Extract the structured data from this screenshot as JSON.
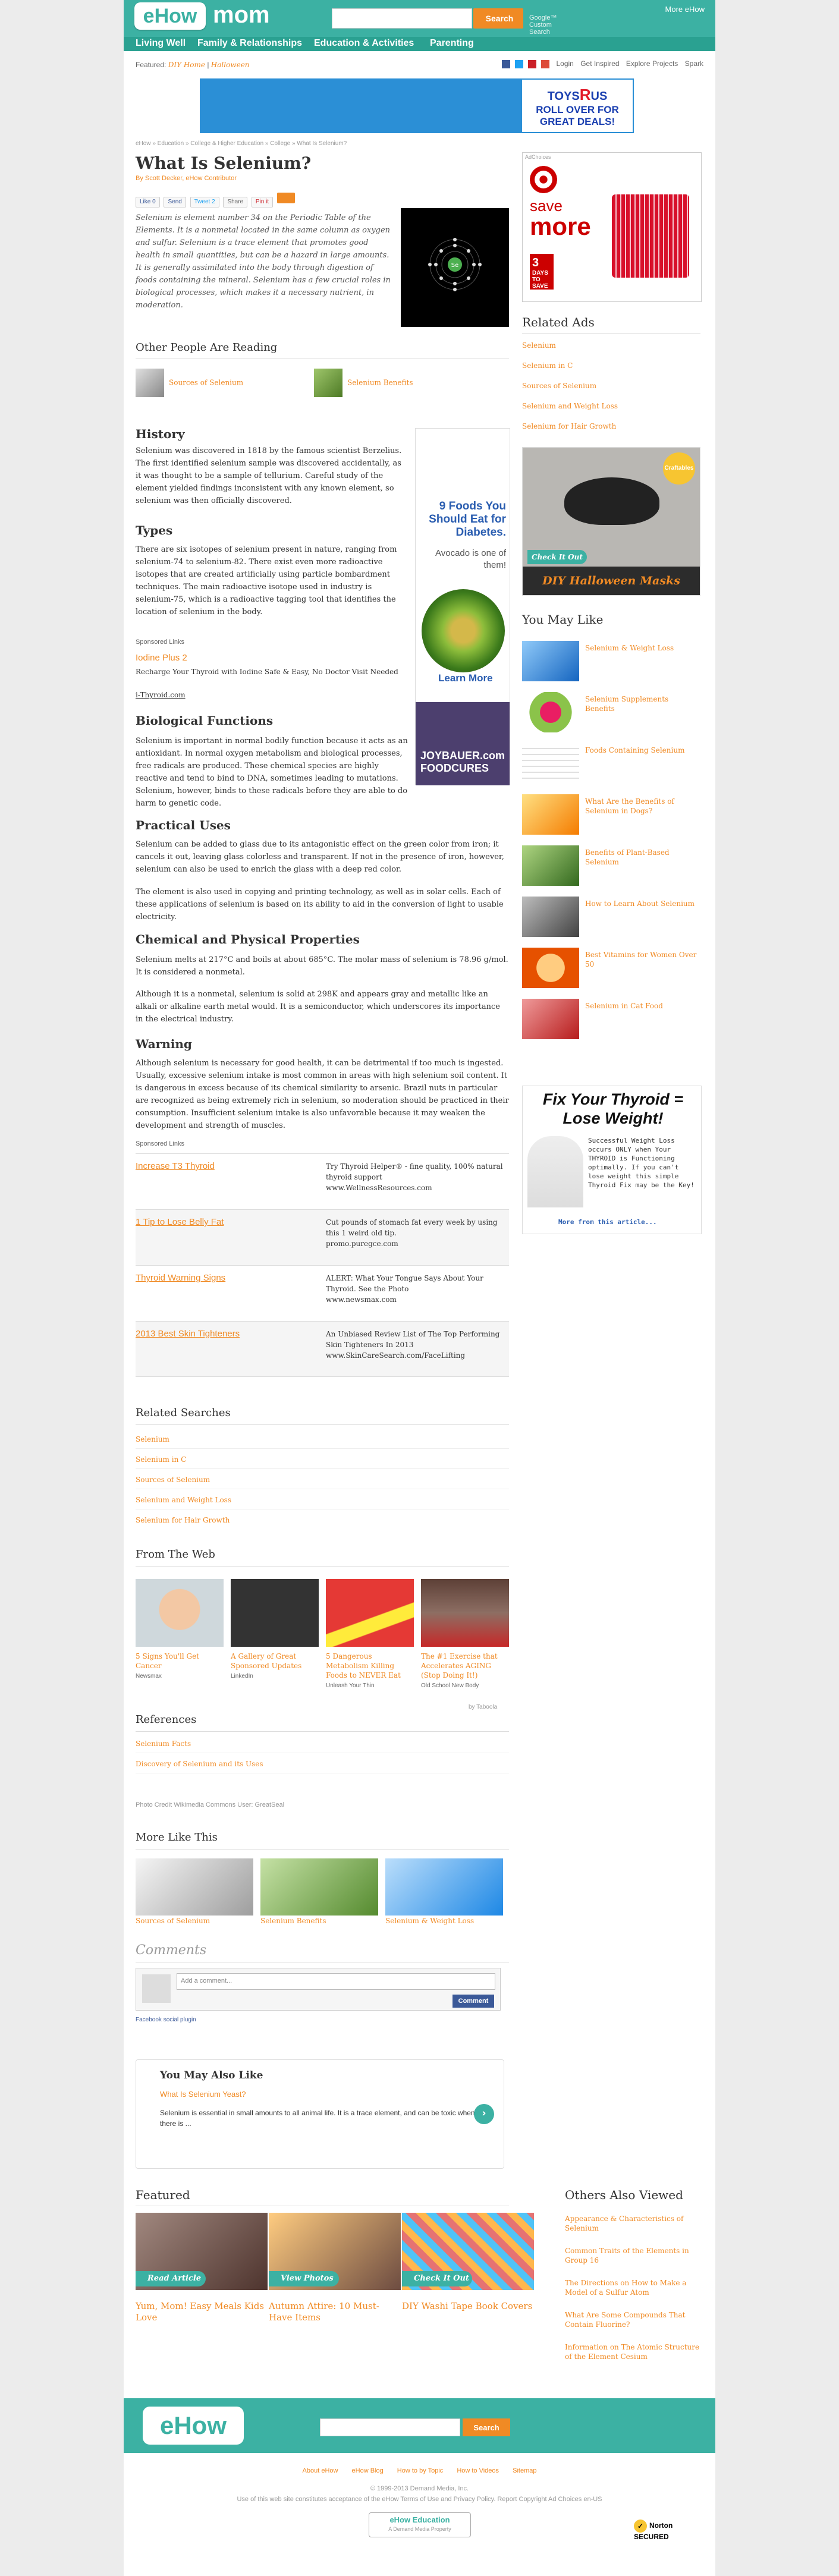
{
  "header": {
    "logo_ehow": "eHow",
    "logo_mom": "mom",
    "search_button": "Search",
    "custom_search": "Google™ Custom Search",
    "more_ehow": "More eHow",
    "nav": [
      "Living Well",
      "Family & Relationships",
      "Education & Activities",
      "Parenting"
    ]
  },
  "featured_bar": {
    "label": "Featured:",
    "links": [
      "DIY Home",
      "Halloween"
    ],
    "right": [
      "Login",
      "Get Inspired",
      "Explore Projects",
      "Spark"
    ]
  },
  "banner_ad": {
    "brand_a": "TOYS",
    "brand_b": "R",
    "brand_c": "US",
    "line1": "ROLL OVER FOR",
    "line2": "GREAT DEALS!"
  },
  "article": {
    "breadcrumb": "eHow » Education » College & Higher Education » College » What Is Selenium?",
    "title": "What Is Selenium?",
    "byline": "By Scott Decker, eHow Contributor",
    "share": {
      "like": "Like",
      "like_count": "0",
      "send": "Send",
      "tweet": "Tweet",
      "tweet_count": "2",
      "share": "Share",
      "pin": "Pin it"
    },
    "intro": "Selenium is element number 34 on the Periodic Table of the Elements. It is a nonmetal located in the same column as oxygen and sulfur. Selenium is a trace element that promotes good health in small quantities, but can be a hazard in large amounts. It is generally assimilated into the body through digestion of foods containing the mineral. Selenium has a few crucial roles in biological processes, which makes it a necessary nutrient, in moderation.",
    "atom_label": "Se",
    "other_reading_heading": "Other People Are Reading",
    "other_reading": [
      "Sources of Selenium",
      "Selenium Benefits"
    ],
    "history_h": "History",
    "history": "Selenium was discovered in 1818 by the famous scientist Berzelius. The first identified selenium sample was discovered accidentally, as it was thought to be a sample of tellurium. Careful study of the element yielded findings inconsistent with any known element, so selenium was then officially discovered.",
    "types_h": "Types",
    "types": "There are six isotopes of selenium present in nature, ranging from selenium-74 to selenium-82. There exist even more radioactive isotopes that are created artificially using particle bombardment techniques. The main radioactive isotope used in industry is selenium-75, which is a radioactive tagging tool that identifies the location of selenium in the body.",
    "sponsored_label": "Sponsored Links",
    "sp_title": "Iodine Plus 2",
    "sp_desc": "Recharge Your Thyroid with Iodine Safe & Easy, No Doctor Visit Needed",
    "sp_url": "i-Thyroid.com",
    "bio_h": "Biological Functions",
    "bio": "Selenium is important in normal bodily function because it acts as an antioxidant. In normal oxygen metabolism and biological processes, free radicals are produced. These chemical species are highly reactive and tend to bind to DNA, sometimes leading to mutations. Selenium, however, binds to these radicals before they are able to do harm to genetic code.",
    "practical_h": "Practical Uses",
    "practical1": "Selenium can be added to glass due to its antagonistic effect on the green color from iron; it cancels it out, leaving glass colorless and transparent. If not in the presence of iron, however, selenium can also be used to enrich the glass with a deep red color.",
    "practical2": "The element is also used in copying and printing technology, as well as in solar cells. Each of these applications of selenium is based on its ability to aid in the conversion of light to usable electricity.",
    "chem_h": "Chemical and Physical Properties",
    "chem1": "Selenium melts at 217°C and boils at about 685°C. The molar mass of selenium is 78.96 g/mol. It is considered a nonmetal.",
    "chem2": "Although it is a nonmetal, selenium is solid at 298K and appears gray and metallic like an alkali or alkaline earth metal would. It is a semiconductor, which underscores its importance in the electrical industry.",
    "warning_h": "Warning",
    "warning": "Although selenium is necessary for good health, it can be detrimental if too much is ingested. Usually, excessive selenium intake is most common in areas with high selenium soil content. It is dangerous in excess because of its chemical similarity to arsenic. Brazil nuts in particular are recognized as being extremely rich in selenium, so moderation should be practiced in their consumption. Insufficient selenium intake is also unfavorable because it may weaken the development and strength of muscles.",
    "inline_ad": {
      "line1": "9 Foods You Should Eat for Diabetes.",
      "line2": "Avocado is one of them!",
      "learn": "Learn More",
      "brand": "JOYBAUER.com FOODCURES"
    }
  },
  "sponsored_table": {
    "label": "Sponsored Links",
    "rows": [
      {
        "title": "Increase T3 Thyroid",
        "desc": "Try Thyroid Helper® - fine quality, 100% natural thyroid support",
        "url": "www.WellnessResources.com"
      },
      {
        "title": "1 Tip to Lose Belly Fat",
        "desc": "Cut pounds of stomach fat every week by using this 1 weird old tip.",
        "url": "promo.puregce.com"
      },
      {
        "title": "Thyroid Warning Signs",
        "desc": "ALERT: What Your Tongue Says About Your Thyroid. See the Photo",
        "url": "www.newsmax.com"
      },
      {
        "title": "2013 Best Skin Tighteners",
        "desc": "An Unbiased Review List of The Top Performing Skin Tighteners In 2013",
        "url": "www.SkinCareSearch.com/FaceLifting"
      }
    ]
  },
  "related_searches": {
    "heading": "Related Searches",
    "items": [
      "Selenium",
      "Selenium in C",
      "Sources of Selenium",
      "Selenium and Weight Loss",
      "Selenium for Hair Growth"
    ]
  },
  "from_the_web": {
    "heading": "From The Web",
    "cards": [
      {
        "caption": "5 Signs You'll Get Cancer",
        "source": "Newsmax"
      },
      {
        "caption": "A Gallery of Great Sponsored Updates",
        "source": "LinkedIn"
      },
      {
        "caption": "5 Dangerous Metabolism Killing Foods to NEVER Eat",
        "source": "Unleash Your Thin"
      },
      {
        "caption": "The #1 Exercise that Accelerates AGING (Stop Doing It!)",
        "source": "Old School New Body"
      }
    ],
    "by": "by Taboola"
  },
  "references": {
    "heading": "References",
    "items": [
      "Selenium Facts",
      "Discovery of Selenium and its Uses"
    ]
  },
  "photo_credit": "Photo Credit Wikimedia Commons User: GreatSeal",
  "more_like_this": {
    "heading": "More Like This",
    "items": [
      "Sources of Selenium",
      "Selenium Benefits",
      "Selenium & Weight Loss"
    ]
  },
  "comments": {
    "heading": "Comments",
    "placeholder": "Add a comment...",
    "button": "Comment",
    "plugin": "Facebook social plugin"
  },
  "you_may_also_like": {
    "heading": "You May Also Like",
    "link": "What Is Selenium Yeast?",
    "desc": "Selenium is essential in small amounts to all animal life. It is a trace element, and can be toxic when there is ..."
  },
  "sidebar": {
    "target_ad": {
      "adchoices": "AdChoices",
      "save": "save",
      "more": "more",
      "tile_num": "3",
      "tile_text": "DAYS TO SAVE"
    },
    "related_ads_heading": "Related Ads",
    "related_ads": [
      "Selenium",
      "Selenium in C",
      "Sources of Selenium",
      "Selenium and Weight Loss",
      "Selenium for Hair Growth"
    ],
    "halloween": {
      "check": "Check It Out",
      "title": "DIY Halloween Masks",
      "badge": "Craftables"
    },
    "you_may_like_heading": "You May Like",
    "you_may_like": [
      "Selenium & Weight Loss",
      "Selenium Supplements Benefits",
      "Foods Containing Selenium",
      "What Are the Benefits of Selenium in Dogs?",
      "Benefits of Plant-Based Selenium",
      "How to Learn About Selenium",
      "Best Vitamins for Women Over 50",
      "Selenium in Cat Food"
    ],
    "thyroid_ad": {
      "headline": "Fix Your Thyroid = Lose Weight!",
      "body": "Successful Weight Loss occurs ONLY when Your THYROID is Functioning optimally. If you can't lose weight this simple Thyroid Fix may be the Key!",
      "more": "More from this article..."
    }
  },
  "featured": {
    "heading": "Featured",
    "cards": [
      {
        "label": "Read Article",
        "caption": "Yum, Mom! Easy Meals Kids Love"
      },
      {
        "label": "View Photos",
        "caption": "Autumn Attire: 10 Must-Have Items"
      },
      {
        "label": "Check It Out",
        "caption": "DIY Washi Tape Book Covers"
      }
    ]
  },
  "others_also_viewed": {
    "heading": "Others Also Viewed",
    "items": [
      "Appearance & Characteristics of Selenium",
      "Common Traits of the Elements in Group 16",
      "The Directions on How to Make a Model of a Sulfur Atom",
      "What Are Some Compounds That Contain Fluorine?",
      "Information on The Atomic Structure of the Element Cesium"
    ]
  },
  "footer": {
    "logo": "eHow",
    "search_button": "Search",
    "links": [
      "About eHow",
      "eHow Blog",
      "How to by Topic",
      "How to Videos",
      "Sitemap"
    ],
    "copyright": "© 1999-2013 Demand Media, Inc.",
    "terms": "Use of this web site constitutes acceptance of the eHow Terms of Use and Privacy Policy. Report Copyright Ad Choices en-US",
    "dm_logo": "eHow Education",
    "dm_sub": "A Demand Media Property",
    "norton": "Norton SECURED"
  },
  "colors": {
    "teal": "#3cb1a3",
    "orange": "#f08a24"
  }
}
